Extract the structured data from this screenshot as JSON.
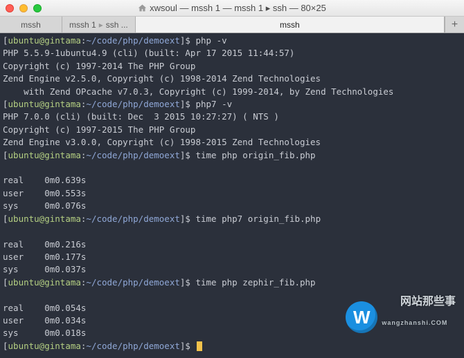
{
  "window": {
    "title": "xwsoul — mssh 1 — mssh 1 ▸ ssh — 80×25"
  },
  "tabs": {
    "t1": "mssh",
    "t2a": "mssh 1",
    "t2b": "ssh ...",
    "active": "mssh"
  },
  "term": {
    "p_user": "ubuntu@gintama",
    "p_colon": ":",
    "p_path": "~/code/php/demoext",
    "p_dollar": "$",
    "lines": {
      "c1": " php -v",
      "l2": "PHP 5.5.9-1ubuntu4.9 (cli) (built: Apr 17 2015 11:44:57)",
      "l3": "Copyright (c) 1997-2014 The PHP Group",
      "l4": "Zend Engine v2.5.0, Copyright (c) 1998-2014 Zend Technologies",
      "l5": "    with Zend OPcache v7.0.3, Copyright (c) 1999-2014, by Zend Technologies",
      "c2": " php7 -v",
      "l7": "PHP 7.0.0 (cli) (built: Dec  3 2015 10:27:27) ( NTS )",
      "l8": "Copyright (c) 1997-2015 The PHP Group",
      "l9": "Zend Engine v3.0.0, Copyright (c) 1998-2015 Zend Technologies",
      "c3": " time php origin_fib.php",
      "blank": "",
      "l12": "real    0m0.639s",
      "l13": "user    0m0.553s",
      "l14": "sys     0m0.076s",
      "c4": " time php7 origin_fib.php",
      "l17": "real    0m0.216s",
      "l18": "user    0m0.177s",
      "l19": "sys     0m0.037s",
      "c5": " time php zephir_fib.php",
      "l22": "real    0m0.054s",
      "l23": "user    0m0.034s",
      "l24": "sys     0m0.018s",
      "c6": " "
    }
  },
  "watermark": {
    "logo_letter": "W",
    "text_main": "网站那些事",
    "text_sub": "wangzhanshi.COM"
  }
}
